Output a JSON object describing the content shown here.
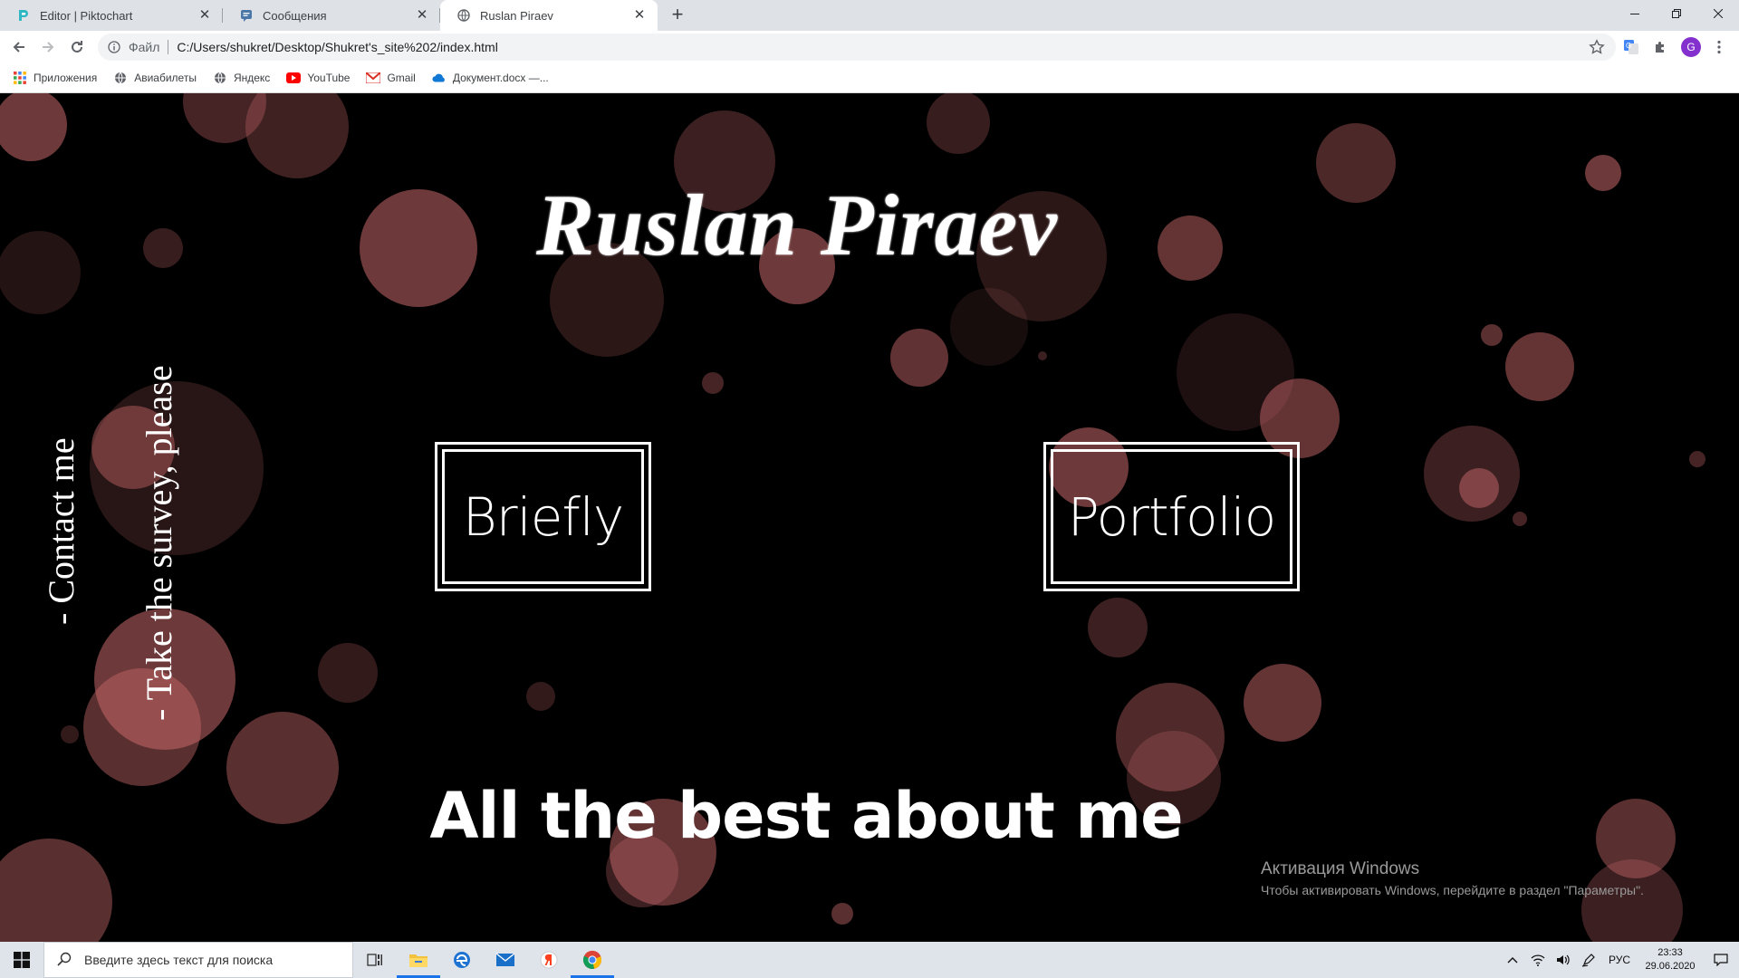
{
  "browser": {
    "tabs": [
      {
        "label": "Editor | Piktochart",
        "icon": "piktochart-icon",
        "active": false
      },
      {
        "label": "Сообщения",
        "icon": "messages-icon",
        "active": false
      },
      {
        "label": "Ruslan Piraev",
        "icon": "globe-icon",
        "active": true
      }
    ],
    "omnibox": {
      "scheme_label": "Файл",
      "url": "C:/Users/shukret/Desktop/Shukret's_site%202/index.html"
    },
    "profile_initial": "G",
    "bookmarks": [
      {
        "label": "Приложения",
        "icon": "apps-grid-icon"
      },
      {
        "label": "Авиабилеты",
        "icon": "globe-icon"
      },
      {
        "label": "Яндекс",
        "icon": "globe-icon"
      },
      {
        "label": "YouTube",
        "icon": "youtube-icon"
      },
      {
        "label": "Gmail",
        "icon": "gmail-icon"
      },
      {
        "label": "Документ.docx —...",
        "icon": "onedrive-icon"
      }
    ]
  },
  "page": {
    "title": "Ruslan Piraev",
    "side_links": {
      "contact": "- Contact me",
      "survey": "- Take the survey, please"
    },
    "nav": {
      "briefly": "Briefly",
      "portfolio": "Portfolio"
    },
    "tagline": "All the best about me",
    "colors": {
      "background": "#000000",
      "bokeh": "#c8686a",
      "text": "#ffffff"
    }
  },
  "windows_activation": {
    "title": "Активация Windows",
    "message": "Чтобы активировать Windows, перейдите в раздел \"Параметры\"."
  },
  "taskbar": {
    "search_placeholder": "Введите здесь текст для поиска",
    "language": "РУС",
    "time": "23:33",
    "date": "29.06.2020"
  }
}
